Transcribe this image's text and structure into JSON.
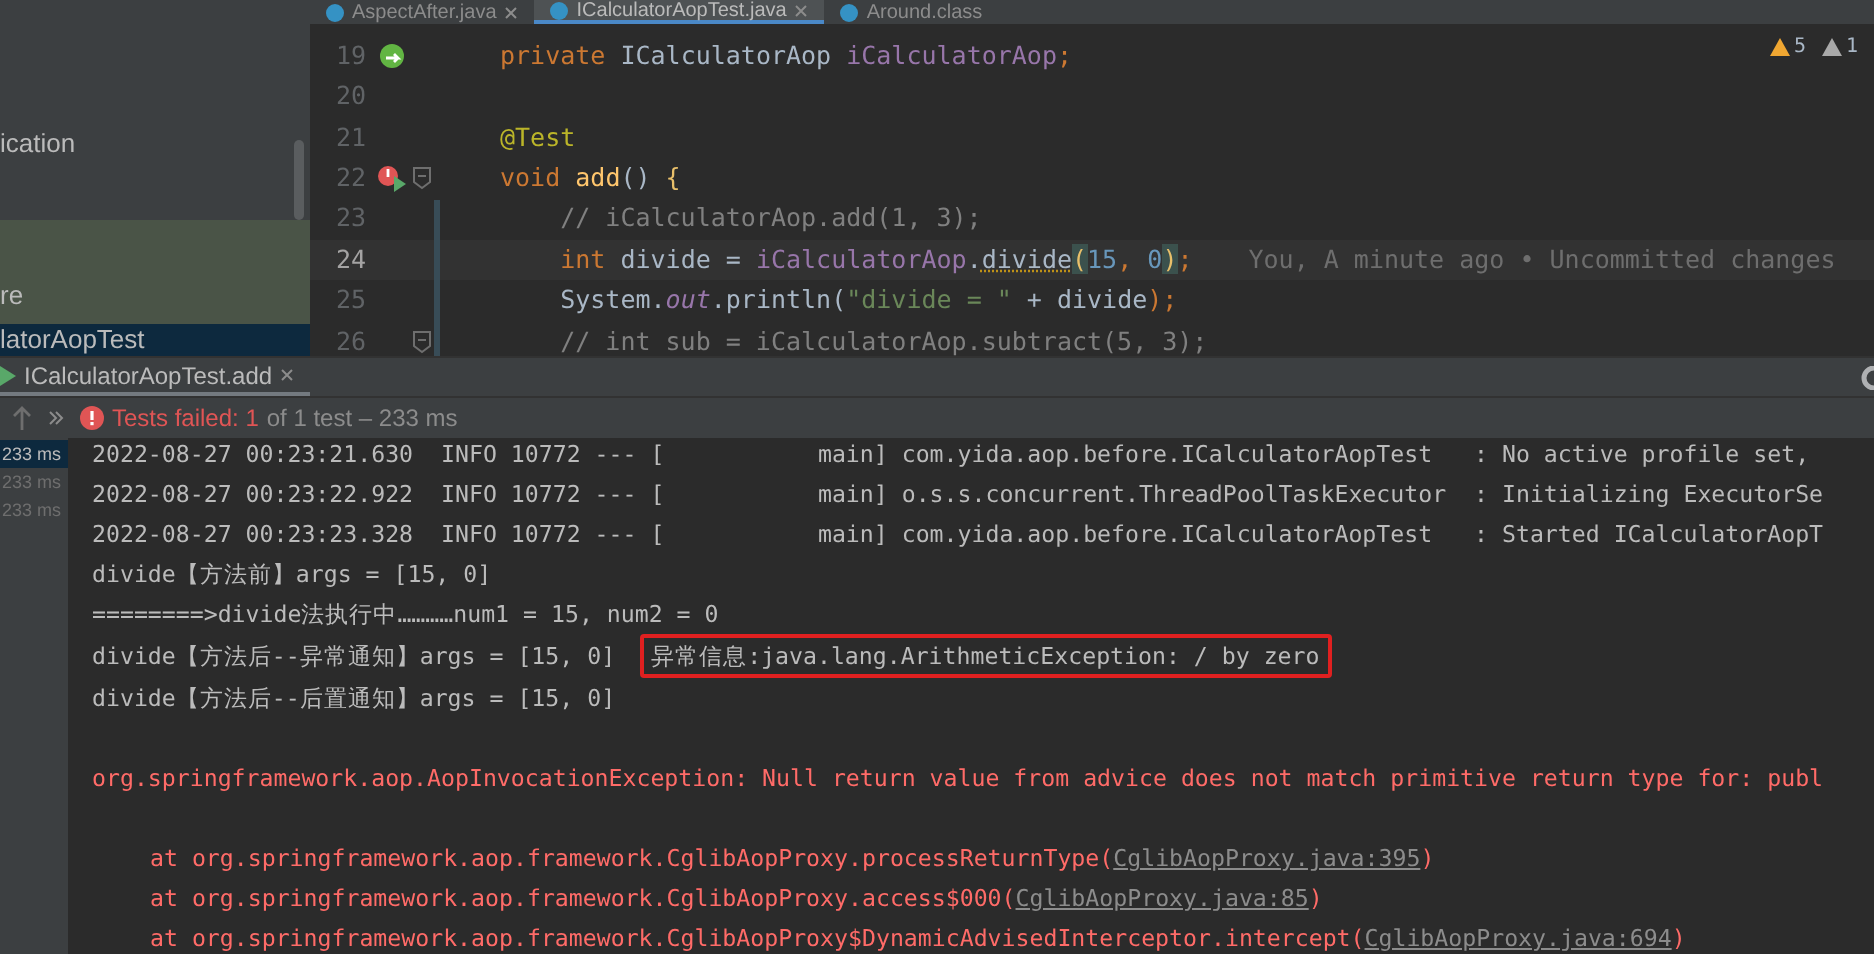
{
  "project_panel": {
    "items": [
      {
        "text": "ication",
        "selected": false,
        "scope": false
      },
      {
        "text": "re",
        "selected": false,
        "scope": true
      },
      {
        "text": "latorAopTest",
        "selected": true,
        "scope": true
      }
    ]
  },
  "editor_tabs": [
    {
      "label": "AspectAfter.java",
      "selected": false,
      "closable": true
    },
    {
      "label": "ICalculatorAopTest.java",
      "selected": true,
      "closable": true
    },
    {
      "label": "Around.class",
      "selected": false,
      "closable": false
    }
  ],
  "inspections": [
    {
      "kind": "warning",
      "count": "5"
    },
    {
      "kind": "weak",
      "count": "1"
    }
  ],
  "code_lines": [
    {
      "number": "19",
      "gutter_icon": {
        "kind": "bean"
      },
      "fold": false,
      "changed": false,
      "current": false,
      "tokens": [
        {
          "text": "private ",
          "kind": "keyword"
        },
        {
          "text": "ICalculatorAop ",
          "kind": "plain"
        },
        {
          "text": "iCalculatorAop",
          "kind": "field"
        },
        {
          "text": ";",
          "kind": "keyword"
        }
      ]
    },
    {
      "number": "20",
      "fold": false,
      "changed": false,
      "current": false
    },
    {
      "number": "21",
      "fold": false,
      "changed": false,
      "current": false,
      "tokens": [
        {
          "text": "@Test",
          "kind": "annotation"
        }
      ]
    },
    {
      "number": "22",
      "gutter_icon": {
        "kind": "run-error"
      },
      "fold": true,
      "changed": false,
      "current": false,
      "tokens": [
        {
          "text": "void ",
          "kind": "keyword"
        },
        {
          "text": "add",
          "kind": "method"
        },
        {
          "text": "() ",
          "kind": "plain"
        },
        {
          "text": "{",
          "kind": "brace"
        }
      ]
    },
    {
      "number": "23",
      "fold": false,
      "changed": true,
      "current": false,
      "tokens": [
        {
          "text": "    // iCalculatorAop.add(1, 3);",
          "kind": "comment"
        }
      ]
    },
    {
      "number": "24",
      "fold": false,
      "changed": true,
      "current": true,
      "blame": "You, A minute ago • Uncommitted changes",
      "tokens": [
        {
          "text": "    int ",
          "kind": "keyword"
        },
        {
          "text": "divide = ",
          "kind": "plain"
        },
        {
          "text": "iCalculatorAop",
          "kind": "field"
        },
        {
          "text": ".",
          "kind": "plain"
        },
        {
          "text": "divide",
          "kind": "call"
        },
        {
          "text": "(",
          "kind": "paren"
        },
        {
          "text": "15",
          "kind": "number"
        },
        {
          "text": ", ",
          "kind": "keyword"
        },
        {
          "text": "0",
          "kind": "number"
        },
        {
          "text": ")",
          "kind": "paren"
        },
        {
          "text": ";",
          "kind": "keyword"
        }
      ]
    },
    {
      "number": "25",
      "fold": false,
      "changed": true,
      "current": false,
      "tokens": [
        {
          "text": "    System.",
          "kind": "plain"
        },
        {
          "text": "out",
          "kind": "static"
        },
        {
          "text": ".println(",
          "kind": "plain"
        },
        {
          "text": "\"divide = \"",
          "kind": "string"
        },
        {
          "text": " + divide",
          "kind": "plain"
        },
        {
          "text": ");",
          "kind": "keyword"
        }
      ]
    },
    {
      "number": "26",
      "fold": true,
      "changed": true,
      "current": false,
      "tokens": [
        {
          "text": "    // int sub = iCalculatorAop.subtract(5, 3);",
          "kind": "comment"
        }
      ]
    }
  ],
  "run_tab": {
    "label": "ICalculatorAopTest.add",
    "selected": true
  },
  "test_status": {
    "failed": "Tests failed: 1",
    "summary": "of 1 test – 233 ms"
  },
  "test_durations": [
    {
      "text": "233 ms",
      "selected": true
    },
    {
      "text": "233 ms",
      "selected": false
    },
    {
      "text": "233 ms",
      "selected": false
    }
  ],
  "console": [
    {
      "kind": "log",
      "text": "2022-08-27 00:23:21.630  INFO 10772 --- [           main] com.yida.aop.before.ICalculatorAopTest   : No active profile set,"
    },
    {
      "kind": "log",
      "text": "2022-08-27 00:23:22.922  INFO 10772 --- [           main] o.s.s.concurrent.ThreadPoolTaskExecutor  : Initializing ExecutorSe"
    },
    {
      "kind": "log",
      "text": "2022-08-27 00:23:23.328  INFO 10772 --- [           main] com.yida.aop.before.ICalculatorAopTest   : Started ICalculatorAopT"
    },
    {
      "kind": "log",
      "text": "divide【方法前】args = [15, 0]"
    },
    {
      "kind": "log",
      "text": "========>divide法执行中…………num1 = 15, num2 = 0"
    },
    {
      "kind": "log",
      "text": "divide【方法后--异常通知】args = [15, 0]",
      "highlight": "异常信息:java.lang.ArithmeticException: / by zero"
    },
    {
      "kind": "log",
      "text": "divide【方法后--后置通知】args = [15, 0]"
    },
    {
      "kind": "error",
      "text": "org.springframework.aop.AopInvocationException: Null return value from advice does not match primitive return type for: publ"
    },
    {
      "kind": "stack",
      "text": "at org.springframework.aop.framework.CglibAopProxy.processReturnType(",
      "link": "CglibAopProxy.java:395",
      "after": ")"
    },
    {
      "kind": "stack",
      "text": "at org.springframework.aop.framework.CglibAopProxy.access$000(",
      "link": "CglibAopProxy.java:85",
      "after": ")"
    },
    {
      "kind": "stack",
      "text": "at org.springframework.aop.framework.CglibAopProxy$DynamicAdvisedInterceptor.intercept(",
      "link": "CglibAopProxy.java:694",
      "after": ")"
    }
  ]
}
